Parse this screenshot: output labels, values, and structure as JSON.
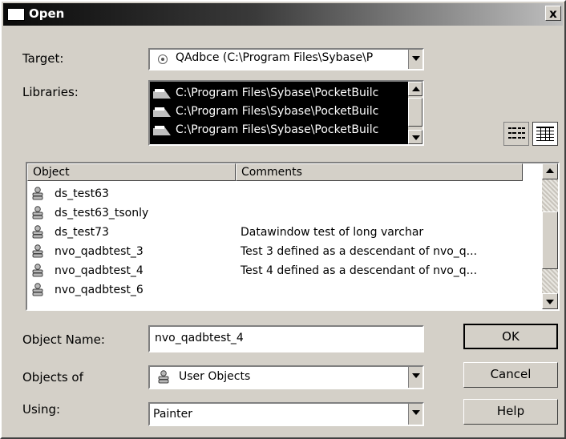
{
  "dialog": {
    "title": "Open",
    "close_label": "x"
  },
  "target": {
    "label": "Target:",
    "value": "QAdbce (C:\\Program Files\\Sybase\\P"
  },
  "libraries": {
    "label": "Libraries:",
    "items": [
      "C:\\Program Files\\Sybase\\PocketBuilc",
      "C:\\Program Files\\Sybase\\PocketBuilc",
      "C:\\Program Files\\Sybase\\PocketBuilc"
    ]
  },
  "object_list": {
    "headers": {
      "object": "Object",
      "comments": "Comments"
    },
    "rows": [
      {
        "name": "ds_test63",
        "comment": ""
      },
      {
        "name": "ds_test63_tsonly",
        "comment": ""
      },
      {
        "name": "ds_test73",
        "comment": "Datawindow test of long varchar"
      },
      {
        "name": "nvo_qadbtest_3",
        "comment": "Test 3 defined as a descendant of nvo_q..."
      },
      {
        "name": "nvo_qadbtest_4",
        "comment": "Test 4 defined as a descendant of nvo_q..."
      },
      {
        "name": "nvo_qadbtest_6",
        "comment": ""
      }
    ]
  },
  "object_name": {
    "label": "Object Name:",
    "value": "nvo_qadbtest_4"
  },
  "objects_of": {
    "label": "Objects of",
    "value": "User Objects"
  },
  "using": {
    "label": "Using:",
    "value": "Painter"
  },
  "buttons": {
    "ok": "OK",
    "cancel": "Cancel",
    "help": "Help"
  },
  "icons": {
    "title": "window-icon",
    "target": "target-radio-icon",
    "library": "library-icon",
    "object": "user-object-icon",
    "view_list": "list-view-icon",
    "view_details": "details-view-icon"
  }
}
